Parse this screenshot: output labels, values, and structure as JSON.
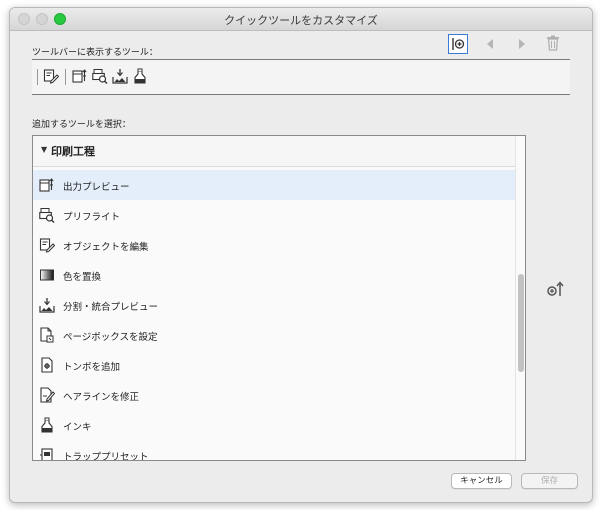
{
  "window": {
    "title": "クイックツールをカスタマイズ"
  },
  "labels": {
    "toolbar_tools": "ツールバーに表示するツール：",
    "add_tools": "追加するツールを選択："
  },
  "group": {
    "label": "印刷工程",
    "expanded": true
  },
  "items": [
    {
      "label": "出力プレビュー",
      "icon": "output-preview-icon",
      "selected": true
    },
    {
      "label": "プリフライト",
      "icon": "preflight-icon"
    },
    {
      "label": "オブジェクトを編集",
      "icon": "edit-object-icon"
    },
    {
      "label": "色を置換",
      "icon": "replace-color-icon"
    },
    {
      "label": "分割・統合プレビュー",
      "icon": "flattener-preview-icon"
    },
    {
      "label": "ページボックスを設定",
      "icon": "set-page-boxes-icon"
    },
    {
      "label": "トンボを追加",
      "icon": "add-printer-marks-icon"
    },
    {
      "label": "ヘアラインを修正",
      "icon": "fix-hairlines-icon"
    },
    {
      "label": "インキ",
      "icon": "ink-icon"
    },
    {
      "label": "トラッププリセット",
      "icon": "trap-presets-icon"
    }
  ],
  "buttons": {
    "cancel": "キャンセル",
    "save": "保存"
  },
  "colors": {
    "selected_row": "#e4eefa",
    "selected_border": "#3a7bd5",
    "zoom_button": "#27c93f"
  }
}
